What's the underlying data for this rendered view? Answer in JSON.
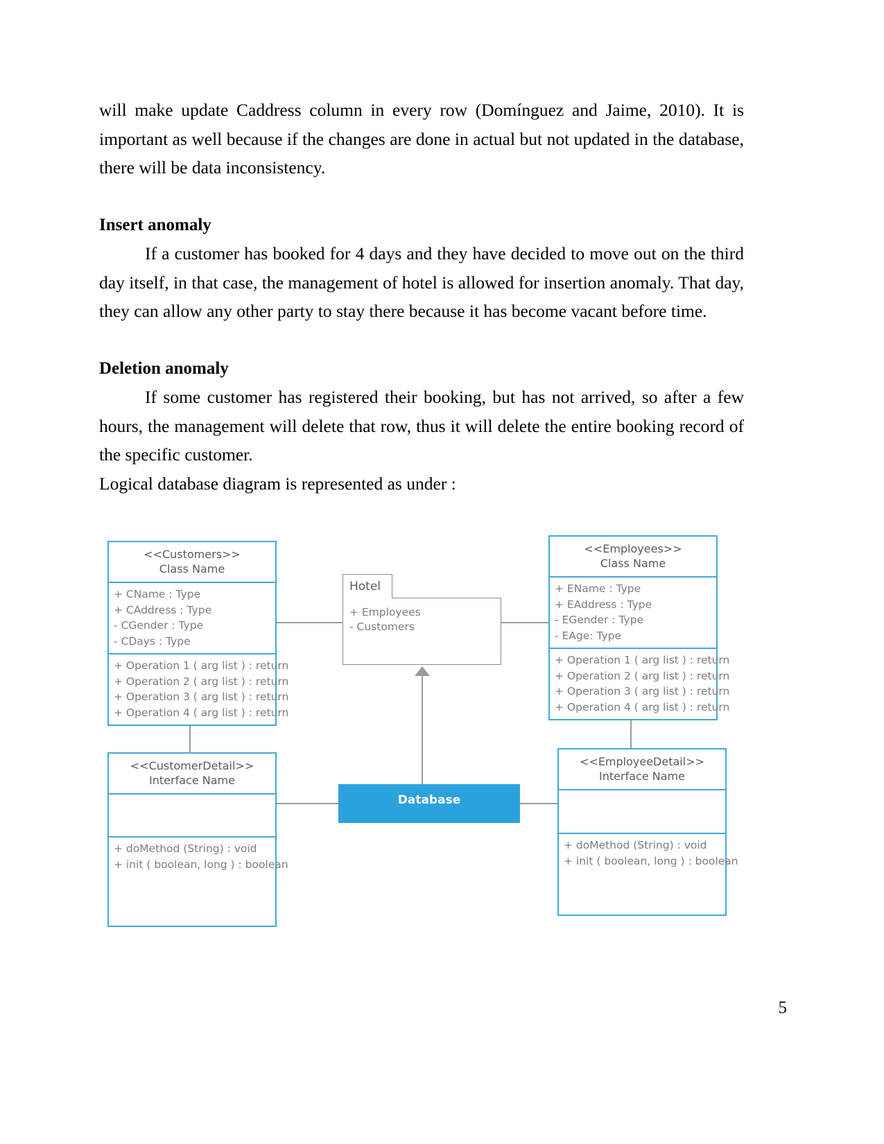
{
  "document": {
    "page_number": "5",
    "paragraphs": {
      "intro": "will make update Caddress column in every row (Domínguez and Jaime, 2010). It is important as well because if the changes are done in actual but not updated in the database, there will be data inconsistency.",
      "insert_heading": "Insert anomaly",
      "insert_body": "If a customer has booked for 4 days and they have decided to move out on the third day itself, in that case, the management of hotel is allowed for insertion anomaly. That day, they can allow any other party to stay there because it has become vacant before time.",
      "deletion_heading": "Deletion anomaly",
      "deletion_body": "If some customer has registered their booking, but has not arrived, so after a few hours, the management will delete that row, thus it will delete the entire booking record of the specific customer.",
      "diagram_caption": "Logical database diagram is represented as under :"
    }
  },
  "diagram": {
    "colors": {
      "class_border": "#3fa9dd",
      "package_border": "#8c8c8c",
      "connector": "#9a9a9a",
      "database_fill": "#2ca2dd",
      "text": "#7d7d7d",
      "title_text": "#5a5a5a"
    },
    "customers": {
      "stereotype": "<<Customers>>",
      "name": "Class Name",
      "attributes": [
        "+ CName : Type",
        "+ CAddress : Type",
        "- CGender : Type",
        "- CDays : Type"
      ],
      "operations": [
        "+ Operation 1 ( arg list ) : return",
        "+ Operation 2 ( arg list ) : return",
        "+ Operation 3 ( arg list ) : return",
        "+ Operation 4 ( arg list ) : return"
      ]
    },
    "employees": {
      "stereotype": "<<Employees>>",
      "name": "Class Name",
      "attributes": [
        "+ EName : Type",
        "+ EAddress : Type",
        "- EGender : Type",
        "- EAge: Type"
      ],
      "operations": [
        "+ Operation 1 ( arg list ) : return",
        "+ Operation 2 ( arg list ) : return",
        "+ Operation 3 ( arg list ) : return",
        "+ Operation 4 ( arg list ) : return"
      ]
    },
    "hotel": {
      "label": "Hotel",
      "members": [
        "+ Employees",
        "- Customers"
      ]
    },
    "customer_detail": {
      "stereotype": "<<CustomerDetail>>",
      "name": "Interface Name",
      "attributes": [],
      "operations": [
        "+ doMethod (String) : void",
        "+ init ( boolean, long ) : boolean"
      ]
    },
    "employee_detail": {
      "stereotype": "<<EmployeeDetail>>",
      "name": "Interface Name",
      "attributes": [],
      "operations": [
        "+ doMethod (String) : void",
        "+ init ( boolean, long ) : boolean"
      ]
    },
    "database": {
      "label": "Database"
    }
  }
}
